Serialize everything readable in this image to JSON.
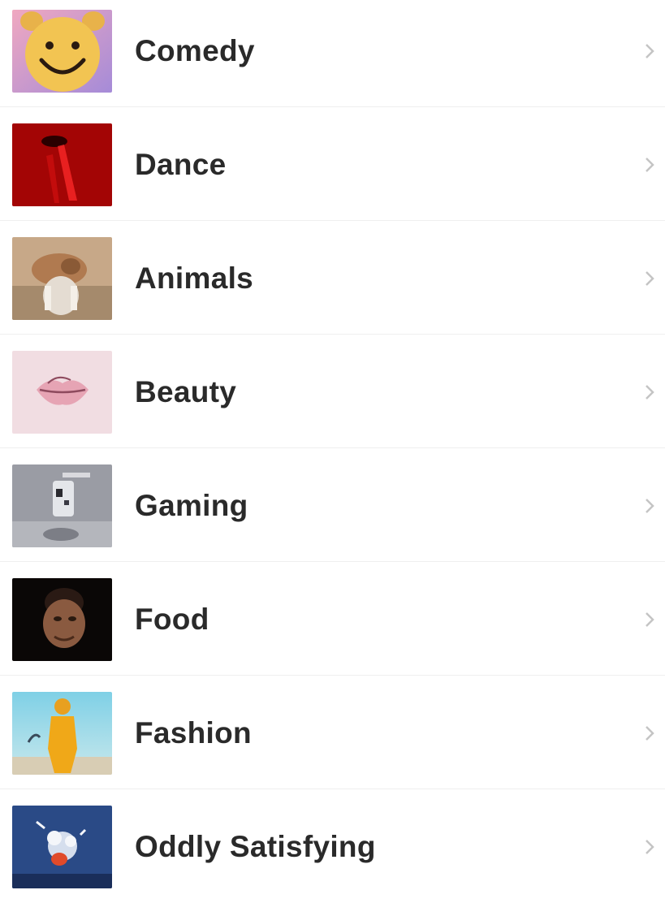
{
  "categories": [
    {
      "label": "Comedy",
      "thumbnail": "smiley-face-thumbnail"
    },
    {
      "label": "Dance",
      "thumbnail": "red-dancer-thumbnail"
    },
    {
      "label": "Animals",
      "thumbnail": "dog-thumbnail"
    },
    {
      "label": "Beauty",
      "thumbnail": "lips-thumbnail"
    },
    {
      "label": "Gaming",
      "thumbnail": "controller-thumbnail"
    },
    {
      "label": "Food",
      "thumbnail": "portrait-thumbnail"
    },
    {
      "label": "Fashion",
      "thumbnail": "yellow-outfit-thumbnail"
    },
    {
      "label": "Oddly Satisfying",
      "thumbnail": "splash-thumbnail"
    }
  ],
  "chevron_icon": "chevron-right-icon"
}
